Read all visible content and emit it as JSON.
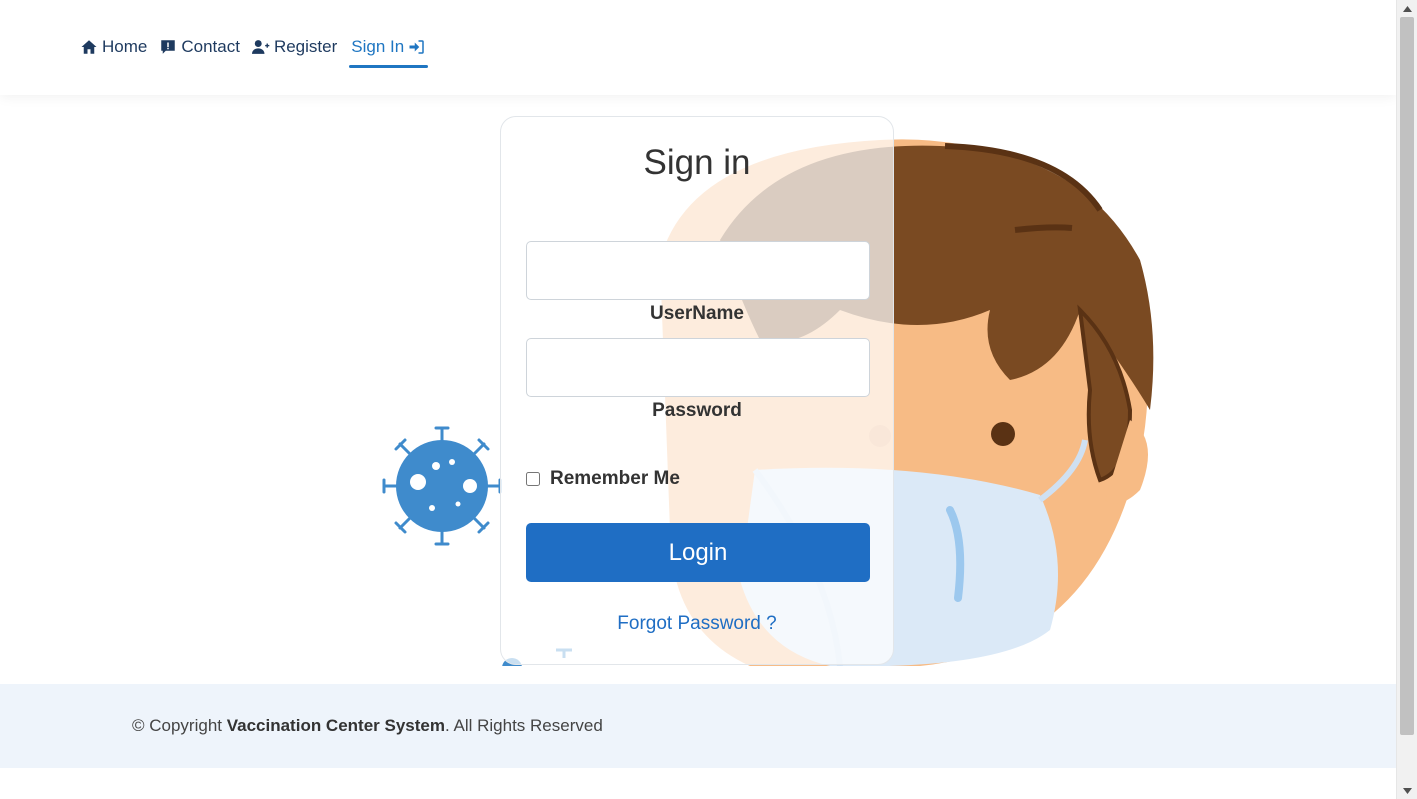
{
  "nav": {
    "items": [
      {
        "label": "Home",
        "icon": "home-icon"
      },
      {
        "label": "Contact",
        "icon": "contact-icon"
      },
      {
        "label": "Register",
        "icon": "user-plus-icon"
      },
      {
        "label": "Sign In",
        "icon": "sign-in-icon"
      }
    ],
    "active": "Sign In"
  },
  "signin": {
    "title": "Sign in",
    "username_label": "UserName",
    "username_value": "",
    "password_label": "Password",
    "password_value": "",
    "remember_label": "Remember Me",
    "remember_checked": false,
    "login_label": "Login",
    "forgot_label": "Forgot Password ?"
  },
  "footer": {
    "prefix": "© Copyright ",
    "brand": "Vaccination Center System",
    "suffix": ". All Rights Reserved"
  },
  "colors": {
    "accent": "#1f6ec4",
    "nav_text": "#1e3a5f",
    "footer_bg": "#eef4fb",
    "hair": "#7a4a22",
    "skin": "#f7bb85",
    "mask": "#dbe9f7",
    "virus": "#3f8bcc"
  }
}
